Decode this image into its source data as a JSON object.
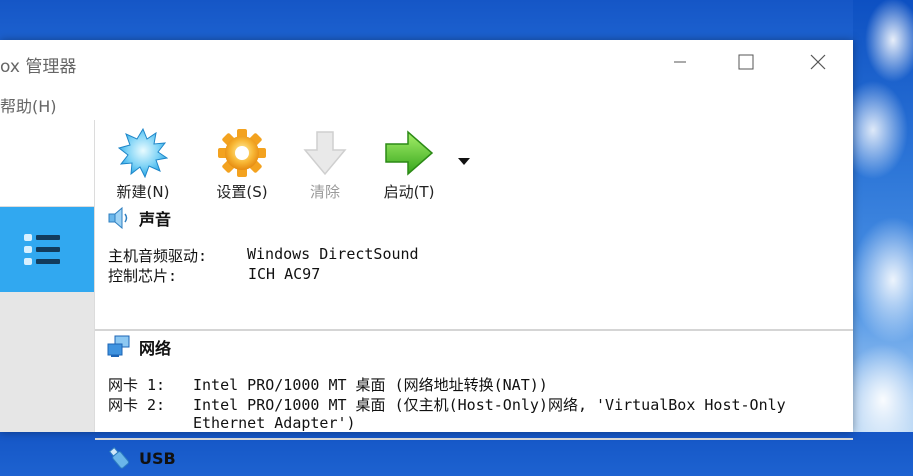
{
  "window": {
    "title": "ox 管理器",
    "menu_help": "帮助(H)"
  },
  "toolbar": {
    "new_label": "新建(N)",
    "settings_label": "设置(S)",
    "discard_label": "清除",
    "start_label": "启动(T)"
  },
  "details": {
    "audio": {
      "title": "声音",
      "rows": [
        {
          "key": "主机音频驱动:",
          "value": "Windows DirectSound"
        },
        {
          "key": "控制芯片:",
          "value": "ICH AC97"
        }
      ]
    },
    "network": {
      "title": "网络",
      "rows": [
        {
          "key": "网卡 1:",
          "value": "Intel PRO/1000 MT 桌面 (网络地址转换(NAT))"
        },
        {
          "key": "网卡 2:",
          "value": "Intel PRO/1000 MT 桌面 (仅主机(Host-Only)网络, 'VirtualBox Host-Only"
        }
      ],
      "continuation": "Ethernet Adapter')"
    },
    "usb": {
      "title": "USB"
    }
  },
  "colors": {
    "selected_tool": "#31a8f0",
    "window_bg": "#ffffff",
    "desktop_blue": "#1556c6"
  },
  "icons": {
    "new": "starburst-new-icon",
    "settings": "gear-icon",
    "discard": "down-arrow-icon",
    "start": "right-arrow-icon",
    "tools": "list-icon",
    "audio": "speaker-icon",
    "network": "network-icon",
    "usb": "usb-icon"
  }
}
